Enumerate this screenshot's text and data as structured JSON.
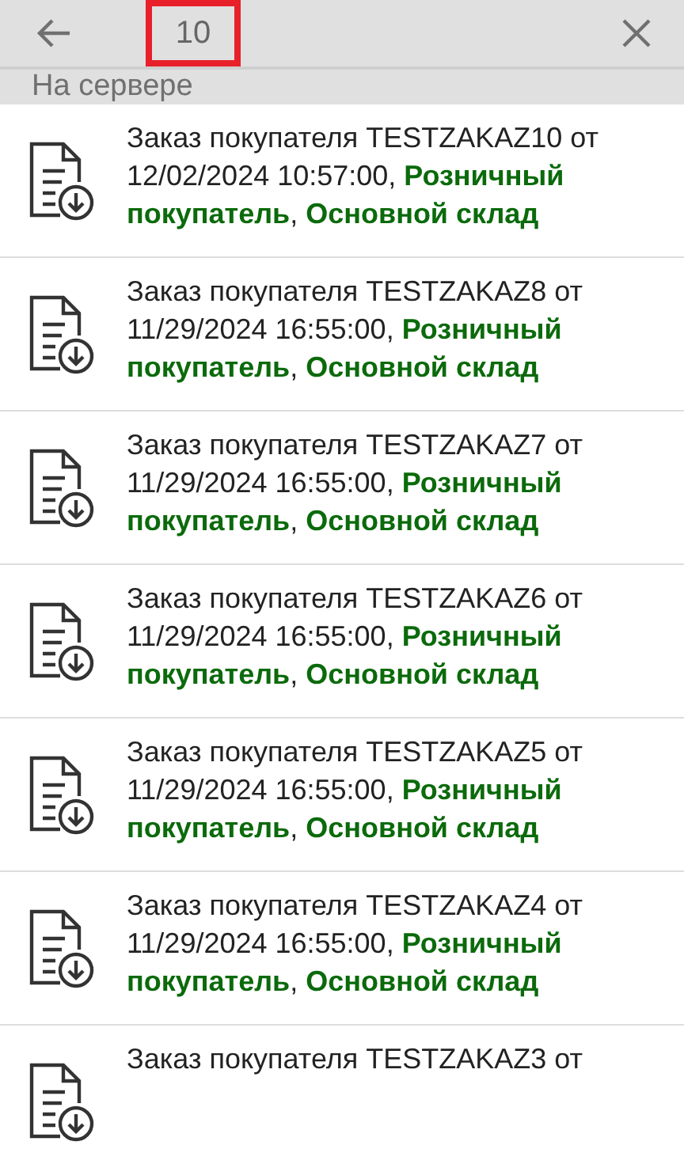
{
  "toolbar": {
    "search": {
      "value": "10",
      "highlighted": true
    }
  },
  "section": {
    "title": "На сервере"
  },
  "orders": [
    {
      "text": "Заказ покупателя TESTZAKAZ10 от 12/02/2024 10:57:00, **Розничный покупатель**, **Основной склад**"
    },
    {
      "text": "Заказ покупателя TESTZAKAZ8 от 11/29/2024 16:55:00, **Розничный покупатель**, **Основной склад**"
    },
    {
      "text": "Заказ покупателя TESTZAKAZ7 от 11/29/2024 16:55:00, **Розничный покупатель**, **Основной склад**"
    },
    {
      "text": "Заказ покупателя TESTZAKAZ6 от 11/29/2024 16:55:00, **Розничный покупатель**, **Основной склад**"
    },
    {
      "text": "Заказ покупателя TESTZAKAZ5 от 11/29/2024 16:55:00, **Розничный покупатель**, **Основной склад**"
    },
    {
      "text": "Заказ покупателя TESTZAKAZ4 от 11/29/2024 16:55:00, **Розничный покупатель**, **Основной склад**"
    },
    {
      "text": "Заказ покупателя TESTZAKAZ3 от"
    }
  ]
}
